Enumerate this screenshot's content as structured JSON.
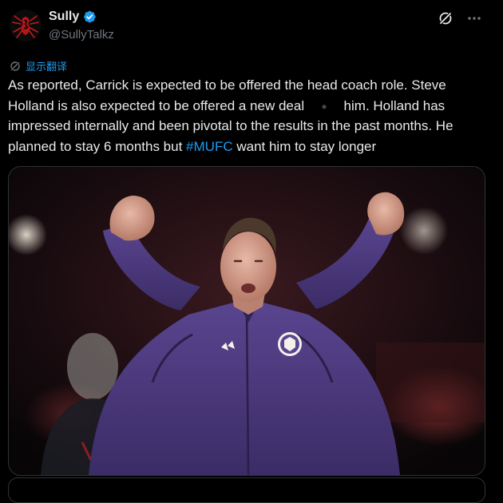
{
  "author": {
    "display_name": "Sully",
    "handle": "@SullyTalkz",
    "verified": true
  },
  "icons": {
    "avatar": "spider-logo-avatar",
    "verified": "verified-badge-icon",
    "grok": "grok-icon",
    "more": "more-options-icon",
    "translate": "translate-icon"
  },
  "translate_label": "显示翻译",
  "tweet": {
    "text_1": "As reported, Carrick is expected to be offered the head coach role. Steve Holland is also expected to be offered a new deal ",
    "text_2": " him. Holland has impressed internally and been pivotal to the results in the past months. He planned to stay 6 months but ",
    "hashtag": "#MUFC",
    "text_3": " want him to stay longer"
  },
  "media": {
    "kind": "photo",
    "subject": "coach-celebrating"
  },
  "colors": {
    "background": "#000000",
    "text": "#e7e9ea",
    "secondary": "#71767b",
    "accent": "#1d9bf0",
    "jacket": "#4b3a7a"
  }
}
